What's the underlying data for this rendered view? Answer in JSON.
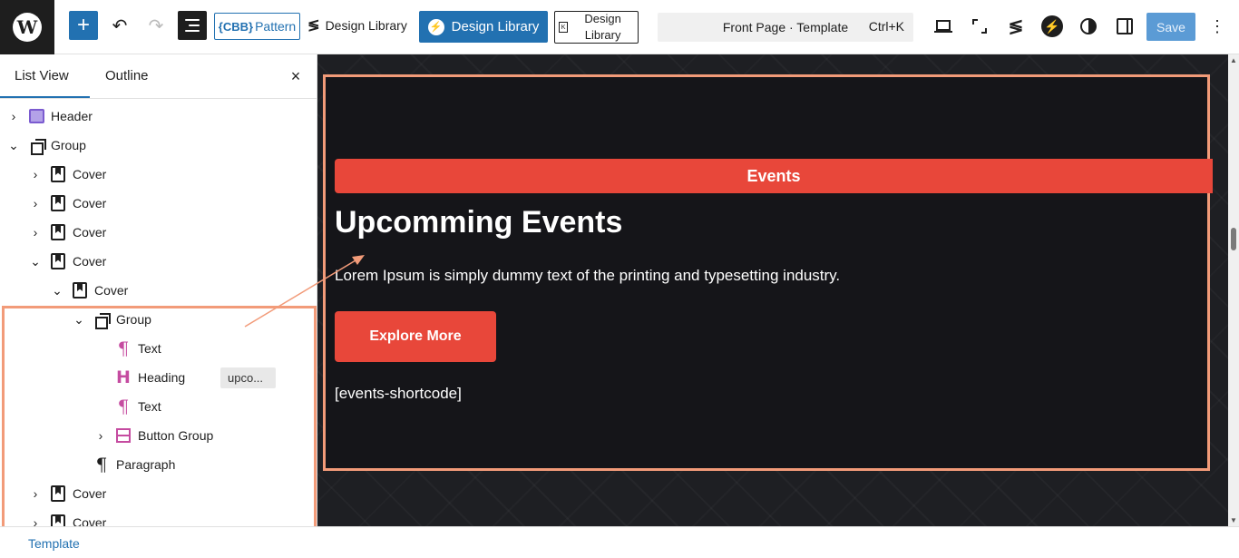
{
  "topbar": {
    "add_label": "+",
    "undo_glyph": "↶",
    "redo_glyph": "↷",
    "cbb_logo": "{CBB}",
    "cbb_label": "Pattern",
    "design_library_label": "Design Library",
    "design_library_primary_label": "Design Library",
    "design_library_outline_label": "Design Library",
    "command_title": "Front Page · Template",
    "command_shortcut": "Ctrl+K",
    "save_label": "Save"
  },
  "sidebar": {
    "tabs": [
      "List View",
      "Outline"
    ],
    "close_glyph": "×",
    "items": [
      {
        "label": "Header"
      },
      {
        "label": "Group"
      },
      {
        "label": "Cover"
      },
      {
        "label": "Cover"
      },
      {
        "label": "Cover"
      },
      {
        "label": "Cover"
      },
      {
        "label": "Cover"
      },
      {
        "label": "Group"
      },
      {
        "label": "Text"
      },
      {
        "label": "Heading",
        "badge": "upco..."
      },
      {
        "label": "Text"
      },
      {
        "label": "Button Group"
      },
      {
        "label": "Paragraph"
      },
      {
        "label": "Cover"
      },
      {
        "label": "Cover"
      }
    ]
  },
  "canvas": {
    "events_label": "Events",
    "heading": "Upcomming Events",
    "lead": "Lorem Ipsum is simply dummy text of the printing and typesetting industry.",
    "button_label": "Explore More",
    "shortcode": "[events-shortcode]"
  },
  "footer": {
    "breadcrumb": "Template"
  },
  "colors": {
    "accent": "#2271b1",
    "brand_red": "#e8473a",
    "highlight": "#f29b79",
    "canvas_bg": "#1e1f23"
  }
}
